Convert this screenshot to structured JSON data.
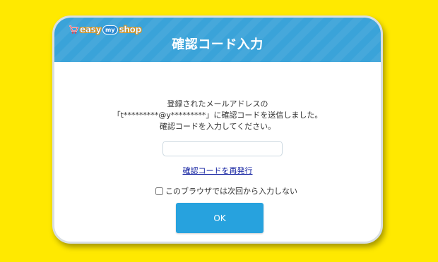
{
  "logo": {
    "brand_left": "easy",
    "brand_mid": "my",
    "brand_right": "shop",
    "icon": "shopping-cart-icon"
  },
  "dialog": {
    "title": "確認コード入力",
    "message_lines": [
      "登録されたメールアドレスの",
      "「t*********@y*********」に確認コードを送信しました。",
      "確認コードを入力してください。"
    ],
    "code_input": {
      "value": "",
      "placeholder": ""
    },
    "resend_link": "確認コードを再発行",
    "remember_checkbox": {
      "label": "このブラウザでは次回から入力しない",
      "checked": false
    },
    "ok_button": "OK"
  },
  "colors": {
    "page_background": "#ffe900",
    "header": "#3aa3d9",
    "ok_button": "#27a2de",
    "link": "#0b1a9e"
  }
}
